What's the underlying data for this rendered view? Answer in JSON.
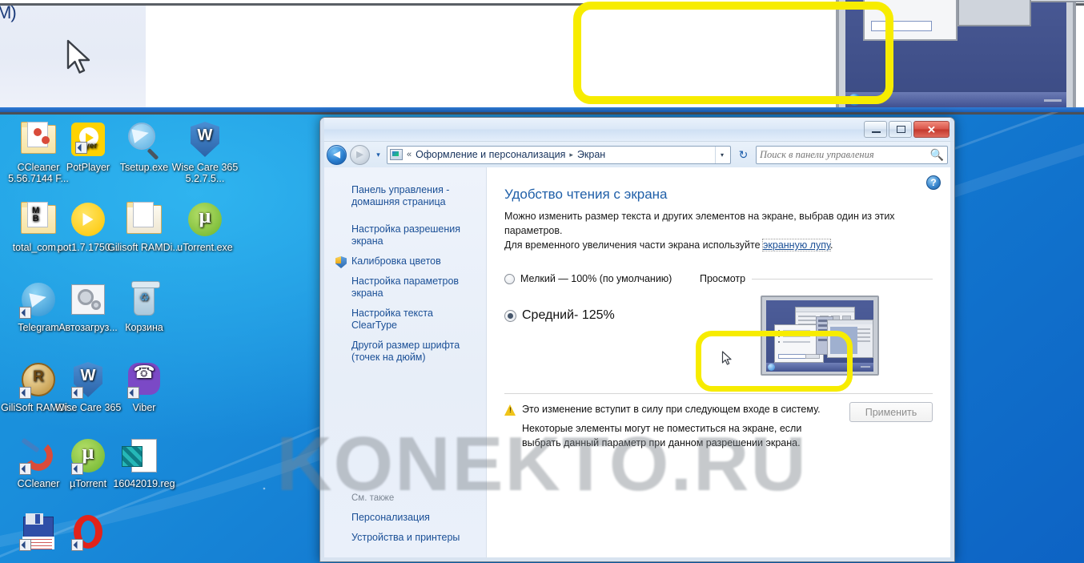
{
  "window": {
    "titlebar_buttons": {
      "minimize": "–",
      "maximize": "❐",
      "close": "✕"
    },
    "address": {
      "chevrons": "«",
      "crumb1": "Оформление и персонализация",
      "separator": "▸",
      "crumb2": "Экран",
      "dropdown": "▾"
    },
    "nav": {
      "back": "◄",
      "forward": "►",
      "history_dropdown": "▾",
      "refresh": "↻"
    },
    "search": {
      "placeholder": "Поиск в панели управления",
      "value": "",
      "icon": "search-icon"
    }
  },
  "sidebar": {
    "links": [
      {
        "label": "Панель управления - домашняя страница",
        "shield": false
      },
      {
        "label": "Настройка разрешения экрана",
        "shield": false
      },
      {
        "label": "Калибровка цветов",
        "shield": true
      },
      {
        "label": "Настройка параметров экрана",
        "shield": false
      },
      {
        "label": "Настройка текста ClearType",
        "shield": false
      },
      {
        "label": "Другой размер шрифта (точек на дюйм)",
        "shield": false
      }
    ],
    "see_also_title": "См. также",
    "see_also_links": [
      {
        "label": "Персонализация"
      },
      {
        "label": "Устройства и принтеры"
      }
    ]
  },
  "main": {
    "heading": "Удобство чтения с экрана",
    "description_line1": "Можно изменить размер текста и других элементов на экране, выбрав один из этих параметров.",
    "description_line2_pre": "Для временного увеличения части экрана используйте ",
    "description_link": "экранную лупу",
    "description_line2_post": ".",
    "options": [
      {
        "label": "Мелкий — 100% (по умолчанию)",
        "checked": false,
        "scale": "100%"
      },
      {
        "label": "Средний- 125%",
        "checked": true,
        "scale": "125%"
      }
    ],
    "preview_label": "Просмотр",
    "warning_line1": "Это изменение вступит в силу при следующем входе в систему.",
    "warning_line2": "Некоторые элементы могут не поместиться на экране, если выбрать данный параметр при данном разрешении экрана.",
    "apply_button": "Применить",
    "help_icon": "help-icon"
  },
  "desktop": {
    "icons": [
      {
        "label": "CCleaner 5.56.7144 F...",
        "art": "folder-cc",
        "shortcut": false
      },
      {
        "label": "PotPlayer",
        "art": "potplayer",
        "shortcut": true
      },
      {
        "label": "Tsetup.exe",
        "art": "telegram-setup",
        "shortcut": false
      },
      {
        "label": "Wise Care 365 5.2.7.5...",
        "art": "wisecare-shield",
        "shortcut": false
      },
      {
        "label": "total_com...",
        "art": "folder-mb",
        "shortcut": false
      },
      {
        "label": "pot1.7.1750...",
        "art": "pot-circle",
        "shortcut": false
      },
      {
        "label": "Gilisoft RAMDi...",
        "art": "folder-plain",
        "shortcut": false
      },
      {
        "label": "uTorrent.exe",
        "art": "utorrent-circle",
        "shortcut": false
      },
      {
        "label": "Telegram",
        "art": "telegram-circle",
        "shortcut": true
      },
      {
        "label": "Автозагруз...",
        "art": "gear-window",
        "shortcut": false
      },
      {
        "label": "Корзина",
        "art": "recycle-bin",
        "shortcut": false
      },
      {
        "label": "GiliSoft RAMDi...",
        "art": "gilisoft-coin",
        "shortcut": true
      },
      {
        "label": "Wise Care 365",
        "art": "wisecare-shield",
        "shortcut": true
      },
      {
        "label": "Viber",
        "art": "viber",
        "shortcut": true
      },
      {
        "label": "CCleaner",
        "art": "ccleaner",
        "shortcut": true
      },
      {
        "label": "µTorrent",
        "art": "utorrent-circle",
        "shortcut": true
      },
      {
        "label": "16042019.reg",
        "art": "reg-file",
        "shortcut": false
      },
      {
        "label": "",
        "art": "floppy",
        "shortcut": true
      },
      {
        "label": "",
        "art": "opera",
        "shortcut": true
      }
    ]
  },
  "top_strip": {
    "fragment_text": "M)"
  },
  "watermark": {
    "text": "KONEKTO.RU"
  },
  "annotations": {
    "callout_top": "yellow-highlight-box",
    "callout_preview": "yellow-highlight-box",
    "color": "#f7ec00"
  }
}
